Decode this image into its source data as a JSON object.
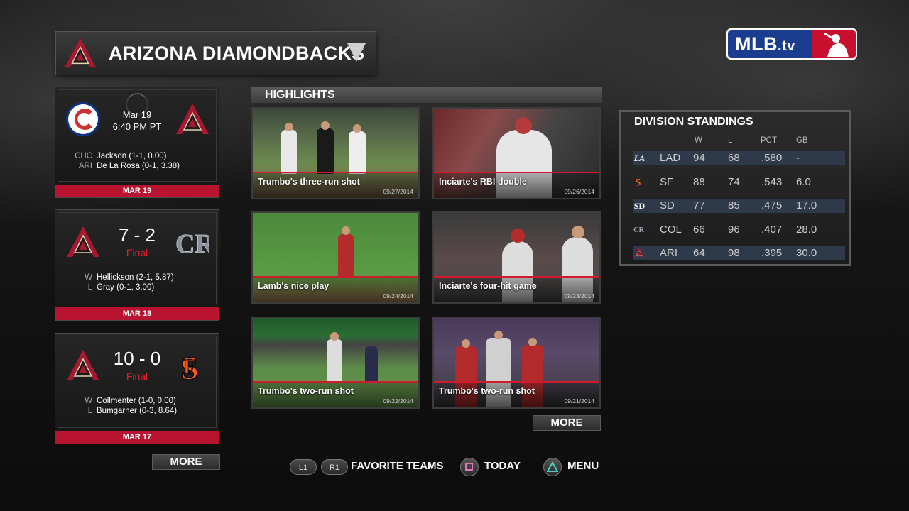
{
  "header": {
    "team_name": "ARIZONA DIAMONDBACKS"
  },
  "brand": {
    "logo_text": "MLB",
    "logo_suffix": ".tv",
    "blue": "#1a3d8f",
    "red": "#c8102e"
  },
  "games": [
    {
      "away": "CHC",
      "home": "ARI",
      "away_icon": "cubs-logo-icon",
      "home_icon": "diamondbacks-logo-icon",
      "date": "Mar 19",
      "time": "6:40 PM PT",
      "pitchers": [
        {
          "label": "CHC",
          "text": "Jackson (1-1, 0.00)"
        },
        {
          "label": "ARI",
          "text": "De La Rosa (0-1, 3.38)"
        }
      ],
      "date_bar": "MAR 19"
    },
    {
      "score": "7 - 2",
      "status": "Final",
      "away_icon": "diamondbacks-logo-icon",
      "home_icon": "rockies-logo-icon",
      "pitchers": [
        {
          "label": "W",
          "text": "Hellickson (2-1, 5.87)"
        },
        {
          "label": "L",
          "text": "Gray (0-1, 3.00)"
        }
      ],
      "date_bar": "MAR 18"
    },
    {
      "score": "10 - 0",
      "status": "Final",
      "away_icon": "diamondbacks-logo-icon",
      "home_icon": "giants-logo-icon",
      "pitchers": [
        {
          "label": "W",
          "text": "Collmenter (1-0, 0.00)"
        },
        {
          "label": "L",
          "text": "Bumgarner (0-3, 8.64)"
        }
      ],
      "date_bar": "MAR 17"
    }
  ],
  "games_more_label": "MORE",
  "highlights": {
    "header": "HIGHLIGHTS",
    "items": [
      {
        "title": "Trumbo's three-run shot",
        "date": "09/27/2014"
      },
      {
        "title": "Inciarte's RBI double",
        "date": "09/26/2014"
      },
      {
        "title": "Lamb's nice play",
        "date": "09/24/2014"
      },
      {
        "title": "Inciarte's four-hit game",
        "date": "09/23/2014"
      },
      {
        "title": "Trumbo's two-run shot",
        "date": "09/22/2014"
      },
      {
        "title": "Trumbo's two-run shot",
        "date": "09/21/2014"
      }
    ],
    "more_label": "MORE"
  },
  "standings": {
    "title": "DIVISION STANDINGS",
    "columns": [
      "W",
      "L",
      "PCT",
      "GB"
    ],
    "rows": [
      {
        "team": "LAD",
        "icon": "dodgers-logo-icon",
        "w": "94",
        "l": "68",
        "pct": ".580",
        "gb": "-"
      },
      {
        "team": "SF",
        "icon": "giants-logo-icon",
        "w": "88",
        "l": "74",
        "pct": ".543",
        "gb": "6.0"
      },
      {
        "team": "SD",
        "icon": "padres-logo-icon",
        "w": "77",
        "l": "85",
        "pct": ".475",
        "gb": "17.0"
      },
      {
        "team": "COL",
        "icon": "rockies-logo-icon",
        "w": "66",
        "l": "96",
        "pct": ".407",
        "gb": "28.0"
      },
      {
        "team": "ARI",
        "icon": "diamondbacks-logo-icon",
        "w": "64",
        "l": "98",
        "pct": ".395",
        "gb": "30.0"
      }
    ]
  },
  "bottom_bar": {
    "l1": "L1",
    "r1": "R1",
    "favorite_teams": "FAVORITE TEAMS",
    "today": "TODAY",
    "menu": "MENU"
  }
}
